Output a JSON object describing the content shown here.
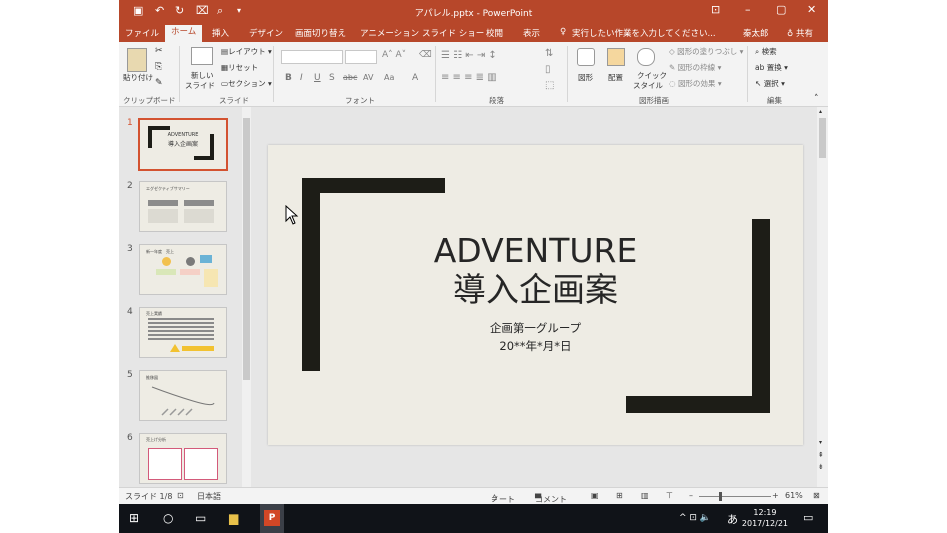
{
  "window": {
    "title": "アパレル.pptx - PowerPoint",
    "user": "秦太郎",
    "share": "共有"
  },
  "tabs": [
    {
      "label": "ファイル"
    },
    {
      "label": "ホーム"
    },
    {
      "label": "挿入"
    },
    {
      "label": "デザイン"
    },
    {
      "label": "画面切り替え"
    },
    {
      "label": "アニメーション"
    },
    {
      "label": "スライド ショー"
    },
    {
      "label": "校閲"
    },
    {
      "label": "表示"
    }
  ],
  "tell_me": "実行したい作業を入力してください...",
  "ribbon": {
    "clipboard": {
      "paste": "貼り付け",
      "label": "クリップボード"
    },
    "slides": {
      "new_slide_1": "新しい",
      "new_slide_2": "スライド",
      "layout": "レイアウト",
      "reset": "リセット",
      "section": "セクション",
      "label": "スライド"
    },
    "font": {
      "label": "フォント",
      "bold": "B",
      "italic": "I",
      "underline": "U",
      "shadow": "S",
      "strike": "abc",
      "spacing": "AV",
      "case": "Aa",
      "color": "A"
    },
    "paragraph": {
      "label": "段落"
    },
    "drawing": {
      "shapes": "図形",
      "arrange": "配置",
      "quick_styles_1": "クイック",
      "quick_styles_2": "スタイル",
      "fill": "図形の塗りつぶし",
      "outline": "図形の枠線",
      "effects": "図形の効果",
      "label": "図形描画"
    },
    "editing": {
      "find": "検索",
      "replace": "置換",
      "select": "選択",
      "label": "編集"
    }
  },
  "slide": {
    "title_line1": "ADVENTURE",
    "title_line2": "導入企画案",
    "subtitle_group": "企画第一グループ",
    "subtitle_date": "20**年*月*日"
  },
  "thumbnails": [
    {
      "num": "1",
      "title": "ADVENTURE",
      "sub": "導入企画案"
    },
    {
      "num": "2",
      "title": "エグゼクティブサマリー",
      "sub": ""
    },
    {
      "num": "3",
      "title": "新一年度　売上",
      "sub": ""
    },
    {
      "num": "4",
      "title": "売上実績",
      "sub": ""
    },
    {
      "num": "5",
      "title": "推移図",
      "sub": ""
    },
    {
      "num": "6",
      "title": "売上げ分析",
      "sub": ""
    }
  ],
  "status": {
    "slide_info": "スライド 1/8",
    "language": "日本語",
    "notes": "ノート",
    "comments": "コメント",
    "zoom": "61%"
  },
  "taskbar": {
    "time": "12:19",
    "date": "2017/12/21",
    "ime": "あ"
  },
  "colors": {
    "accent": "#b7472a",
    "slide_bg": "#eeece4",
    "bar": "#1d1d17"
  }
}
